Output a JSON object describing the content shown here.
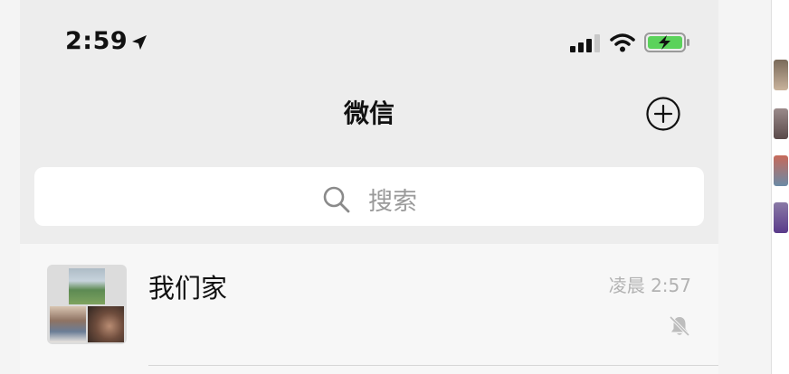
{
  "status_bar": {
    "time": "2:59",
    "location_icon": "location-arrow-icon",
    "signal_icon": "cellular-signal-icon",
    "wifi_icon": "wifi-icon",
    "battery_icon": "battery-charging-icon"
  },
  "nav": {
    "title": "微信",
    "add_icon": "plus-circle-icon"
  },
  "search": {
    "placeholder": "搜索",
    "icon": "search-icon"
  },
  "chats": [
    {
      "name": "我们家",
      "time": "凌晨 2:57",
      "muted": true,
      "mute_icon": "bell-slash-icon"
    }
  ],
  "colors": {
    "background": "#ededed",
    "list_background": "#f7f7f7",
    "battery_green": "#5bd25b",
    "muted_text": "#b2b2b2"
  }
}
